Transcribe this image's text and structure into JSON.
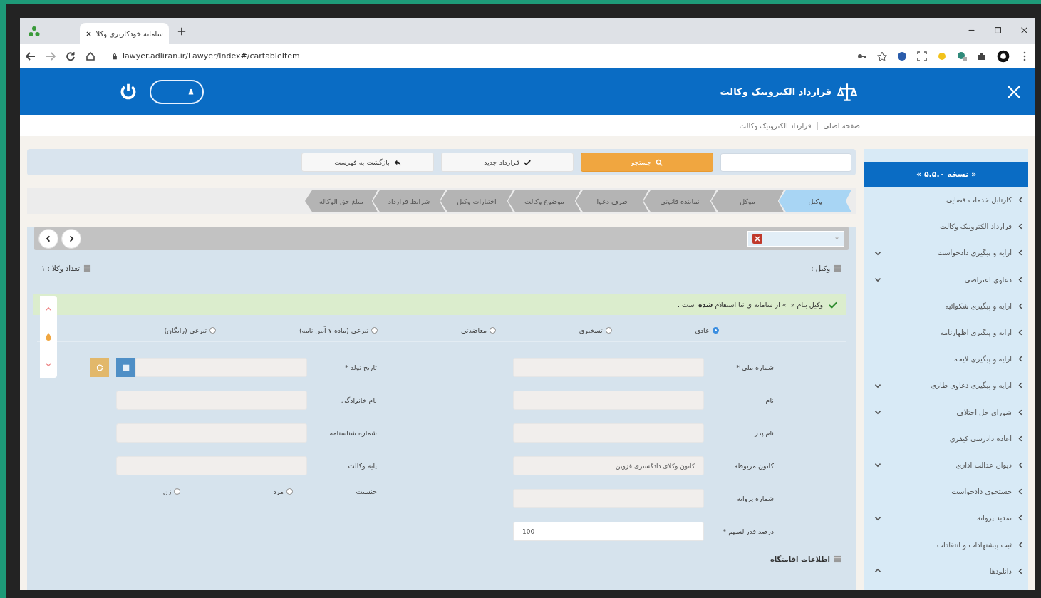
{
  "browser": {
    "tab_title": "سامانه خودکاربری وکلا",
    "url": "lawyer.adliran.ir/Lawyer/Index#/cartableItem"
  },
  "header": {
    "title": "قرارداد الکترونیک وکالت",
    "toggle_on": true
  },
  "breadcrumb": [
    "صفحه اصلی",
    "قرارداد الکترونیک وکالت"
  ],
  "toolbar": {
    "search_button": "جستجو",
    "new_button": "قرارداد جدید",
    "back_button": "بازگشت به فهرست"
  },
  "steps": [
    {
      "label": "وکیل",
      "selected": true
    },
    {
      "label": "موکل",
      "selected": false
    },
    {
      "label": "نماینده قانونی",
      "selected": false
    },
    {
      "label": "طرف دعوا",
      "selected": false
    },
    {
      "label": "موضوع وکالت",
      "selected": false
    },
    {
      "label": "اختیارات وکیل",
      "selected": false
    },
    {
      "label": "شرایط قرارداد",
      "selected": false
    },
    {
      "label": "مبلغ حق الوکاله",
      "selected": false
    }
  ],
  "sidebar": {
    "version": "« نسخه ۵.۵.۰ »",
    "items": [
      {
        "label": "کارتابل خدمات قضایی",
        "kind": "link"
      },
      {
        "label": "قرارداد الکترونیک وکالت",
        "kind": "link"
      },
      {
        "label": "ارایه و پیگیری دادخواست",
        "kind": "group",
        "expanded": false
      },
      {
        "label": "دعاوی اعتراضی",
        "kind": "group",
        "expanded": false
      },
      {
        "label": "ارایه و پیگیری شکوائیه",
        "kind": "link"
      },
      {
        "label": "ارایه و پیگیری اظهارنامه",
        "kind": "link"
      },
      {
        "label": "ارایه و پیگیری لایحه",
        "kind": "link"
      },
      {
        "label": "ارایه و پیگیری دعاوی طاری",
        "kind": "group",
        "expanded": false
      },
      {
        "label": "شورای حل اختلاف",
        "kind": "group",
        "expanded": false
      },
      {
        "label": "اعاده دادرسی کیفری",
        "kind": "link"
      },
      {
        "label": "دیوان عدالت اداری",
        "kind": "group",
        "expanded": false
      },
      {
        "label": "جستجوی دادخواست",
        "kind": "link"
      },
      {
        "label": "تمدید پروانه",
        "kind": "group",
        "expanded": false
      },
      {
        "label": "ثبت پیشنهادات و انتقادات",
        "kind": "link"
      },
      {
        "label": "دانلودها",
        "kind": "group",
        "expanded": true
      }
    ]
  },
  "form": {
    "lawyer_label": "وکیل :",
    "count_label": "تعداد وکلا : ۱",
    "alert": "وکیل بنام «  » از سامانه ی ثنا استعلام **شده** است .",
    "types": [
      {
        "label": "عادی",
        "selected": true
      },
      {
        "label": "تسخیری",
        "selected": false
      },
      {
        "label": "معاضدتی",
        "selected": false
      },
      {
        "label": "تبرعی (ماده ۷ آیین نامه)",
        "selected": false
      },
      {
        "label": "تبرعی (رایگان)",
        "selected": false
      }
    ],
    "fields_right": [
      {
        "label": "شماره ملی *",
        "disabled": true
      },
      {
        "label": "نام",
        "disabled": true
      },
      {
        "label": "نام پدر",
        "disabled": true
      },
      {
        "label": "کانون مربوطه",
        "value": "کانون وکلای دادگستری قزوین",
        "disabled": true
      },
      {
        "label": "شماره پروانه",
        "disabled": true
      },
      {
        "label": "درصد قدرالسهم *",
        "value": "100",
        "disabled": false
      }
    ],
    "fields_left": [
      {
        "label": "تاریخ تولد *",
        "kind": "date",
        "disabled": true
      },
      {
        "label": "نام خانوادگی",
        "kind": "text",
        "disabled": true
      },
      {
        "label": "شماره شناسنامه",
        "kind": "text",
        "disabled": true
      },
      {
        "label": "پایه وکالت",
        "kind": "text",
        "disabled": true
      }
    ],
    "gender": {
      "label": "جنسیت",
      "options": [
        {
          "label": "مرد",
          "selected": false
        },
        {
          "label": "زن",
          "selected": false
        }
      ]
    },
    "residence_label": "اطلاعات اقامتگاه"
  }
}
